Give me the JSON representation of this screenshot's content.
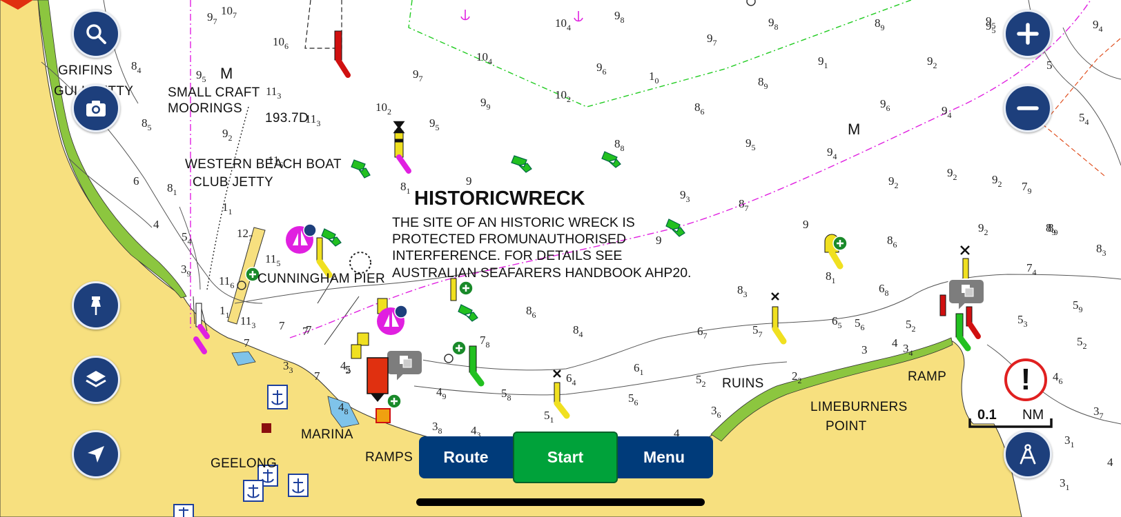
{
  "chart_title": "HISTORICWRECK",
  "chart_note": [
    "THE SITE OF AN HISTORIC WRECK IS",
    "PROTECTED FROMUNAUTHORISED",
    "INTERFERENCE. FOR DETAILS SEE",
    "AUSTRALIAN SEAFARERS HANDBOOK AHP20."
  ],
  "places": {
    "grifins": "GRIFINS",
    "gull_jetty": "GULL JETTY",
    "small_craft_1": "SMALL CRAFT",
    "small_craft_2": "MOORINGS",
    "mark_value": "193.7D",
    "western_beach_1": "WESTERN BEACH BOAT",
    "western_beach_2": "CLUB JETTY",
    "cunningham": "CUNNINGHAM PIER",
    "marina": "MARINA",
    "geelong": "GEELONG",
    "ramps": "RAMPS",
    "ruins": "RUINS",
    "limeburners_1": "LIMEBURNERS",
    "limeburners_2": "POINT",
    "ramp": "RAMP",
    "m1": "M",
    "m2": "M"
  },
  "bottom_bar": {
    "route": "Route",
    "start": "Start",
    "menu": "Menu"
  },
  "scale": {
    "value": "0.1",
    "unit": "NM"
  },
  "alert_glyph": "!",
  "icons": {
    "search": "search-icon",
    "camera": "camera-icon",
    "pin": "pin-icon",
    "layers": "layers-icon",
    "navigate": "navigate-arrow-icon",
    "zoom_in": "plus-icon",
    "zoom_out": "minus-icon",
    "compass": "compass-icon"
  },
  "colors": {
    "land": "#f7e07f",
    "green_shore": "#8cc63f",
    "water": "#ffffff",
    "control_button": "#1d3f7c",
    "start_button": "#00a23a",
    "bar": "#003b7a",
    "magenta": "#e020e0",
    "alert_red": "#e02020"
  },
  "soundings": [
    {
      "t": "97"
    },
    {
      "t": "106"
    },
    {
      "t": "84"
    },
    {
      "t": "95"
    },
    {
      "t": "113"
    },
    {
      "t": "113"
    },
    {
      "t": "85"
    },
    {
      "t": "92"
    },
    {
      "t": "116"
    },
    {
      "t": "81"
    },
    {
      "t": "6"
    },
    {
      "t": "11"
    },
    {
      "t": "4"
    },
    {
      "t": "54"
    },
    {
      "t": "39"
    },
    {
      "t": "11"
    },
    {
      "t": "127"
    },
    {
      "t": "115"
    },
    {
      "t": "116"
    },
    {
      "t": "113"
    },
    {
      "t": "7"
    },
    {
      "t": "7"
    },
    {
      "t": "33"
    },
    {
      "t": "7"
    },
    {
      "t": "107"
    },
    {
      "t": "104"
    },
    {
      "t": "97"
    },
    {
      "t": "102"
    },
    {
      "t": "99"
    },
    {
      "t": "95"
    },
    {
      "t": "9"
    },
    {
      "t": "81"
    },
    {
      "t": "104"
    },
    {
      "t": "98"
    },
    {
      "t": "96"
    },
    {
      "t": "10"
    },
    {
      "t": "102"
    },
    {
      "t": "86"
    },
    {
      "t": "88"
    },
    {
      "t": "89"
    },
    {
      "t": "97"
    },
    {
      "t": "98"
    },
    {
      "t": "91"
    },
    {
      "t": "89"
    },
    {
      "t": "92"
    },
    {
      "t": "95"
    },
    {
      "t": "96"
    },
    {
      "t": "95"
    },
    {
      "t": "93"
    },
    {
      "t": "94"
    },
    {
      "t": "94"
    },
    {
      "t": "92"
    },
    {
      "t": "92"
    },
    {
      "t": "87"
    },
    {
      "t": "9"
    },
    {
      "t": "92"
    },
    {
      "t": "86"
    },
    {
      "t": "89"
    },
    {
      "t": "95"
    },
    {
      "t": "94"
    },
    {
      "t": "92"
    },
    {
      "t": "54"
    },
    {
      "t": "89"
    },
    {
      "t": "79"
    },
    {
      "t": "83"
    },
    {
      "t": "74"
    },
    {
      "t": "68"
    },
    {
      "t": "81"
    },
    {
      "t": "83"
    },
    {
      "t": "86"
    },
    {
      "t": "84"
    },
    {
      "t": "78"
    },
    {
      "t": "67"
    },
    {
      "t": "57"
    },
    {
      "t": "65"
    },
    {
      "t": "56"
    },
    {
      "t": "52"
    },
    {
      "t": "34"
    },
    {
      "t": "3"
    },
    {
      "t": "4"
    },
    {
      "t": "61"
    },
    {
      "t": "64"
    },
    {
      "t": "58"
    },
    {
      "t": "56"
    },
    {
      "t": "52"
    },
    {
      "t": "51"
    },
    {
      "t": "36"
    },
    {
      "t": "22"
    },
    {
      "t": "49"
    },
    {
      "t": "43"
    },
    {
      "t": "38"
    },
    {
      "t": "4"
    },
    {
      "t": "53"
    },
    {
      "t": "59"
    },
    {
      "t": "52"
    },
    {
      "t": "46"
    },
    {
      "t": "37"
    },
    {
      "t": "31"
    },
    {
      "t": "31"
    },
    {
      "t": "4"
    },
    {
      "t": "9"
    },
    {
      "t": "7"
    },
    {
      "t": "7"
    },
    {
      "t": "42"
    },
    {
      "t": "48"
    },
    {
      "t": "8"
    },
    {
      "t": "5"
    },
    {
      "t": "5"
    }
  ]
}
